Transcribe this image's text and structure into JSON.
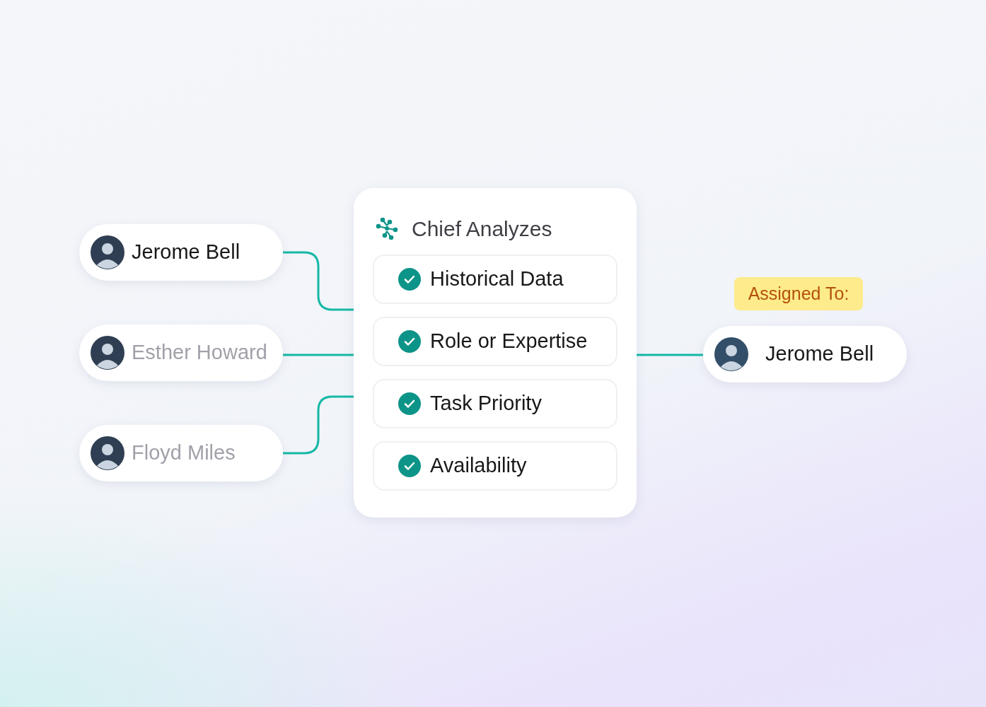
{
  "candidates": [
    {
      "name": "Jerome Bell",
      "selected": true
    },
    {
      "name": "Esther Howard",
      "selected": false
    },
    {
      "name": "Floyd Miles",
      "selected": false
    }
  ],
  "analysis": {
    "title": "Chief Analyzes",
    "criteria": [
      {
        "label": "Historical Data",
        "checked": true
      },
      {
        "label": "Role or Expertise",
        "checked": true
      },
      {
        "label": "Task Priority",
        "checked": true
      },
      {
        "label": "Availability",
        "checked": true
      }
    ]
  },
  "assignment": {
    "badge": "Assigned To:",
    "name": "Jerome Bell"
  }
}
